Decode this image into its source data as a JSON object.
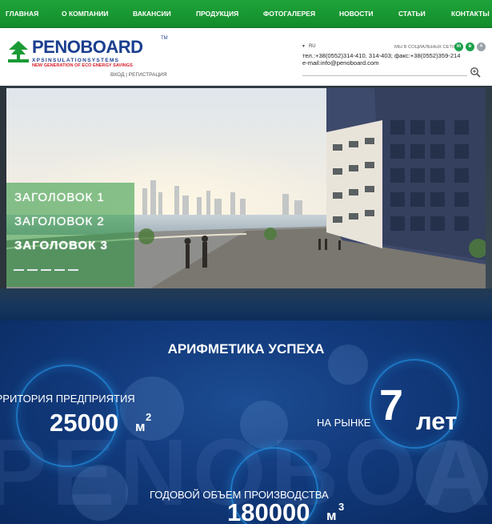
{
  "nav": {
    "items": [
      {
        "label": "ГЛАВНАЯ"
      },
      {
        "label": "О КОМПАНИИ"
      },
      {
        "label": "ВАКАНСИИ"
      },
      {
        "label": "ПРОДУКЦИЯ"
      },
      {
        "label": "ФОТОГАЛЕРЕЯ"
      },
      {
        "label": "НОВОСТИ"
      },
      {
        "label": "СТАТЬИ"
      },
      {
        "label": "КОНТАКТЫ"
      }
    ],
    "color": "#1a9b35"
  },
  "logo": {
    "name": "PENOBOARD",
    "tm": "TM",
    "line1": "XPSINSULATIONSYSTEMS",
    "line2": "NEW GENERATION OF ECO ENERGY SAVINGS"
  },
  "header": {
    "login": "ВХОД | РЕГИСТРАЦИЯ",
    "language": "RU",
    "social_label": "МЫ В СОЦИАЛЬНЫХ СЕТЯХ",
    "social_icons": [
      "linkedin-icon",
      "vk-icon",
      "close-icon"
    ],
    "phones": "тел.:+38(0552)314-410, 314-403; факс:+38(0552)359-214",
    "email": "e-mail:info@penoboard.com",
    "search_placeholder": ""
  },
  "hero": {
    "headings": [
      "ЗАГОЛОВОК 1",
      "ЗАГОЛОВОК 2",
      "ЗАГОЛОВОК 3"
    ],
    "active_heading": 3,
    "slides_count": 5
  },
  "stats": {
    "title": "АРИФМЕТИКА УСПЕХА",
    "territory_label": "ТЕРРИТОРИЯ ПРЕДПРИЯТИЯ",
    "territory_value": "25000",
    "territory_unit": "м",
    "territory_sup": "2",
    "market_label": "НА РЫНКЕ",
    "market_value": "7",
    "market_unit": "лет",
    "volume_label": "ГОДОВОЙ ОБЪЕМ ПРОИЗВОДСТВА",
    "volume_value": "180000",
    "volume_unit": "м",
    "volume_sup": "3",
    "watermark": "PENOBOARD"
  }
}
